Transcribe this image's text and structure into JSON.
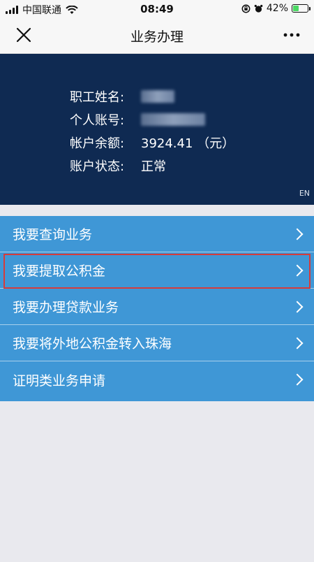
{
  "status_bar": {
    "carrier": "中国联通",
    "time": "08:49",
    "battery": "42%",
    "battery_level": 0.42
  },
  "nav": {
    "title": "业务办理"
  },
  "account": {
    "name_label": "职工姓名:",
    "account_label": "个人账号:",
    "balance_label": "帐户余额:",
    "balance_value": "3924.41 （元）",
    "status_label": "账户状态:",
    "status_value": "正常",
    "lang_toggle": "EN"
  },
  "menu": {
    "items": [
      {
        "label": "我要查询业务"
      },
      {
        "label": "我要提取公积金"
      },
      {
        "label": "我要办理贷款业务"
      },
      {
        "label": "我要将外地公积金转入珠海"
      },
      {
        "label": "证明类业务申请"
      }
    ]
  },
  "colors": {
    "card_bg": "#0f2a52",
    "menu_bg": "#3f97d6",
    "highlight": "#d63b3b",
    "page_bg": "#e9e9ee"
  }
}
